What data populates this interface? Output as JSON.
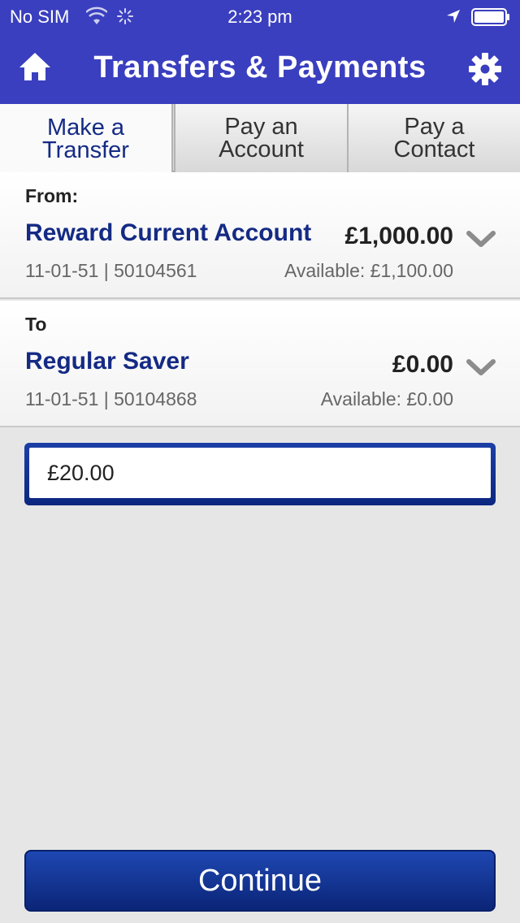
{
  "status_bar": {
    "carrier": "No SIM",
    "time": "2:23 pm",
    "icons": [
      "wifi-icon",
      "activity-spinner-icon",
      "location-arrow-icon",
      "battery-icon"
    ]
  },
  "header": {
    "title": "Transfers & Payments",
    "home_icon": "home-icon",
    "settings_icon": "gear-icon",
    "background": "#3a3fbf"
  },
  "tabs": [
    {
      "label": "Make a\nTransfer",
      "active": true
    },
    {
      "label": "Pay an\nAccount",
      "active": false
    },
    {
      "label": "Pay a\nContact",
      "active": false
    }
  ],
  "from": {
    "label": "From:",
    "account_name": "Reward Current Account",
    "balance": "£1,000.00",
    "sort_account": "11-01-51 | 50104561",
    "available": "Available: £1,100.00"
  },
  "to": {
    "label": "To",
    "account_name": "Regular Saver",
    "balance": "£0.00",
    "sort_account": "11-01-51 | 50104868",
    "available": "Available: £0.00"
  },
  "amount": {
    "value": "£20.00"
  },
  "continue_label": "Continue",
  "colors": {
    "brand_blue": "#3a3fbf",
    "account_name": "#142a84",
    "button_blue": "#0b2780"
  }
}
